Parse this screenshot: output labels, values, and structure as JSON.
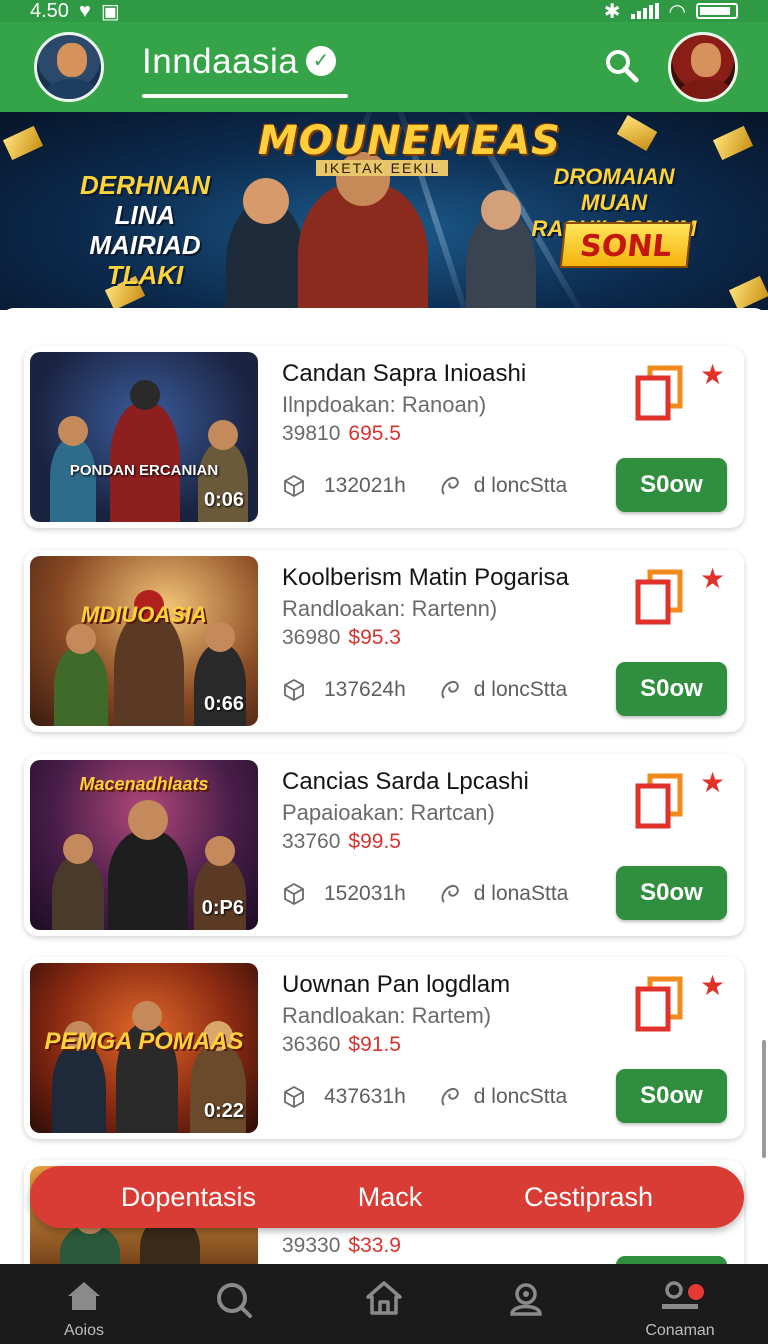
{
  "status_bar": {
    "time": "4.50"
  },
  "header": {
    "title": "Inndaasia"
  },
  "banner": {
    "title": "MOUNEMEAS",
    "subtitle": "IKETAK EEKIL",
    "left_text": [
      "DERHNAN",
      "LINA MAIRIAD",
      "TLAKI"
    ],
    "right_text": [
      "DROMAIAN MUAN",
      "RASHII SOMUM"
    ],
    "badge": "SONL"
  },
  "cards": [
    {
      "title": "Candan Sapra Inioashi",
      "subtitle": "Ilnpdoakan: Ranoan)",
      "old_price": "39810",
      "new_price": "695.5",
      "duration": "0:06",
      "thumb_text": "PONDAN ERCANIAN",
      "views": "132021h",
      "tag": "d loncStta",
      "button": "S0ow"
    },
    {
      "title": "Koolberism Matin Pogarisa",
      "subtitle": "Randloakan: Rartenn)",
      "old_price": "36980",
      "new_price": "$95.3",
      "duration": "0:66",
      "thumb_text": "MDIUOASIA",
      "views": "137624h",
      "tag": "d loncStta",
      "button": "S0ow"
    },
    {
      "title": "Cancias Sarda Lpcashi",
      "subtitle": "Papaioakan: Rartcan)",
      "old_price": "33760",
      "new_price": "$99.5",
      "duration": "0:P6",
      "thumb_text": "Macenadhlaats",
      "views": "152031h",
      "tag": "d lonaStta",
      "button": "S0ow"
    },
    {
      "title": "Uownan Pan logdlam",
      "subtitle": "Randloakan: Rartem)",
      "old_price": "36360",
      "new_price": "$91.5",
      "duration": "0:22",
      "thumb_text": "PEMGA POMAAS",
      "views": "437631h",
      "tag": "d loncStta",
      "button": "S0ow"
    },
    {
      "old_price": "39330",
      "new_price": "$33.9"
    }
  ],
  "action_bar": {
    "items": [
      "Dopentasis",
      "Mack",
      "Cestiprash"
    ]
  },
  "bottom_nav": {
    "items": [
      {
        "label": "Aoios",
        "icon": "home-icon"
      },
      {
        "label": "",
        "icon": "search-icon"
      },
      {
        "label": "",
        "icon": "house-outline-icon"
      },
      {
        "label": "",
        "icon": "profile-icon"
      },
      {
        "label": "Conaman",
        "icon": "account-icon"
      }
    ]
  },
  "colors": {
    "primary_green": "#35a348",
    "button_green": "#2f8f3f",
    "accent_red": "#d93c35",
    "price_red": "#d4342e"
  }
}
